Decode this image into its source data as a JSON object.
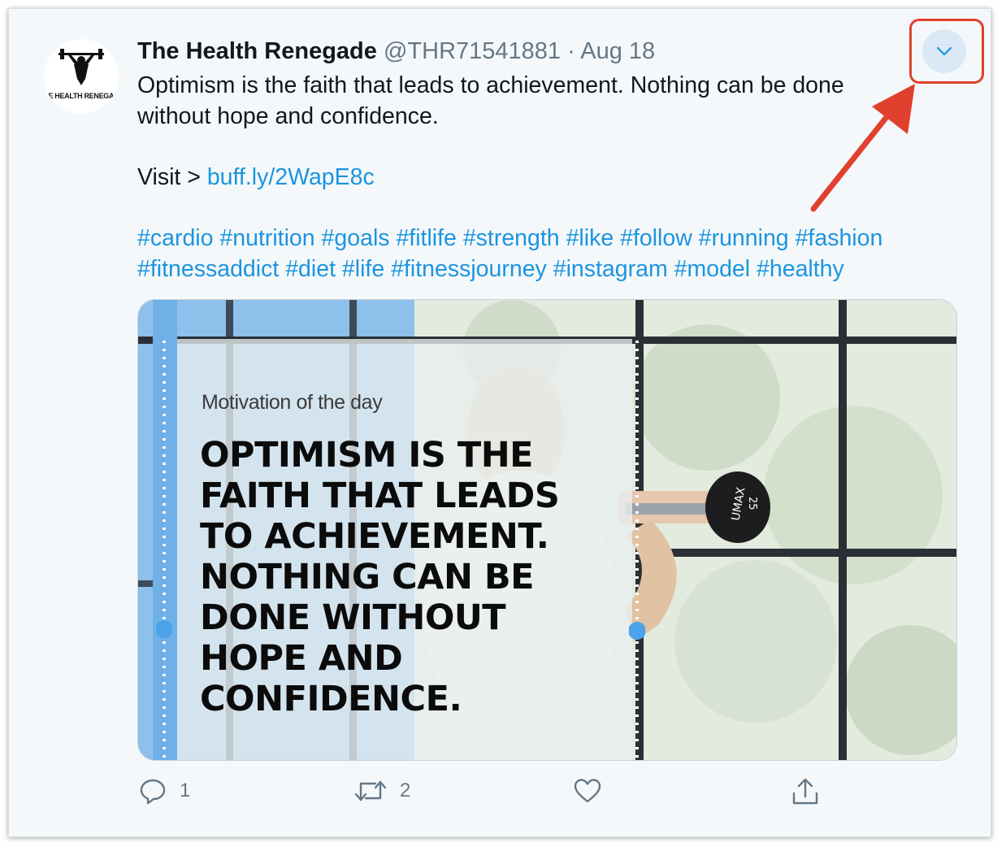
{
  "tweet": {
    "avatar_text": "THE HEALTH RENEGADE",
    "display_name": "The Health Renegade",
    "handle": "@THR71541881",
    "separator": "·",
    "date": "Aug 18",
    "text_line1": "Optimism is the faith that leads to achievement. Nothing can be done",
    "text_line2": "without hope and confidence.",
    "visit_prefix": "Visit > ",
    "link": "buff.ly/2WapE8c",
    "hashtags_line1": "#cardio #nutrition #goals #fitlife #strength #like #follow #running #fashion",
    "hashtags_line2": "#fitnessaddict #diet #life #fitnessjourney #instagram #model #healthy"
  },
  "media": {
    "subtitle": "Motivation of the day",
    "quote_lines": [
      "OPTIMISM IS THE",
      "FAITH THAT LEADS",
      "TO ACHIEVEMENT.",
      "NOTHING CAN BE",
      "DONE WITHOUT",
      "HOPE AND",
      "CONFIDENCE."
    ],
    "plate_brand": "UMAX",
    "plate_weight": "25"
  },
  "actions": {
    "reply_count": "1",
    "retweet_count": "2"
  },
  "icons": {
    "caret": "chevron-down-icon",
    "reply": "reply-icon",
    "retweet": "retweet-icon",
    "like": "heart-icon",
    "share": "share-icon"
  },
  "colors": {
    "link": "#1b95e0",
    "annotation": "#e2402f",
    "secondary_text": "#657786"
  }
}
